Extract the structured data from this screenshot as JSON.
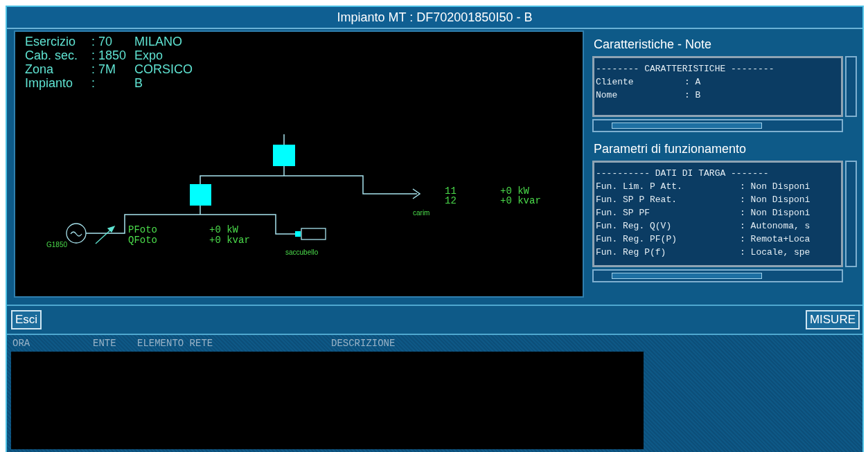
{
  "window": {
    "title": "Impianto MT  : DF702001850I50 - B"
  },
  "info": [
    {
      "label": "Esercizio",
      "value": ": 70",
      "name": "MILANO"
    },
    {
      "label": "Cab. sec.",
      "value": ": 1850",
      "name": "Expo"
    },
    {
      "label": "Zona",
      "value": ": 7M",
      "name": "CORSICO"
    },
    {
      "label": "Impianto",
      "value": ":",
      "name": "B"
    }
  ],
  "diagram": {
    "generator": "G1850",
    "load": "saccubello",
    "feeder": "carim",
    "plant_readings": [
      {
        "label": "PFoto",
        "value": "+0 kW"
      },
      {
        "label": "QFoto",
        "value": "+0 kvar"
      }
    ],
    "feeder_readings": [
      {
        "label": "11",
        "value": "+0 kW"
      },
      {
        "label": "12",
        "value": "+0 kvar"
      }
    ]
  },
  "panels": [
    {
      "title": "Caratteristiche - Note",
      "heading": "-------- CARATTERISTICHE --------",
      "rows": [
        {
          "label": "Cliente",
          "value": ": A"
        },
        {
          "label": "Nome",
          "value": ": B"
        }
      ]
    },
    {
      "title": "Parametri di funzionamento",
      "heading": "---------- DATI DI TARGA -------",
      "rows": [
        {
          "label": "Fun. Lim. P Att.",
          "value": ": Non Disponi"
        },
        {
          "label": "Fun. SP P Reat.",
          "value": ": Non Disponi"
        },
        {
          "label": "Fun. SP PF",
          "value": ": Non Disponi"
        },
        {
          "label": "Fun. Reg. Q(V)",
          "value": ": Autonoma, s"
        },
        {
          "label": "Fun. Reg. PF(P)",
          "value": ": Remota+Loca"
        },
        {
          "label": "Fun. Reg P(f)",
          "value": ": Locale, spe"
        }
      ]
    }
  ],
  "buttons": {
    "exit": "Esci",
    "measures": "MISURE"
  },
  "events": {
    "columns": [
      "ORA",
      "ENTE",
      "ELEMENTO RETE",
      "DESCRIZIONE"
    ]
  }
}
